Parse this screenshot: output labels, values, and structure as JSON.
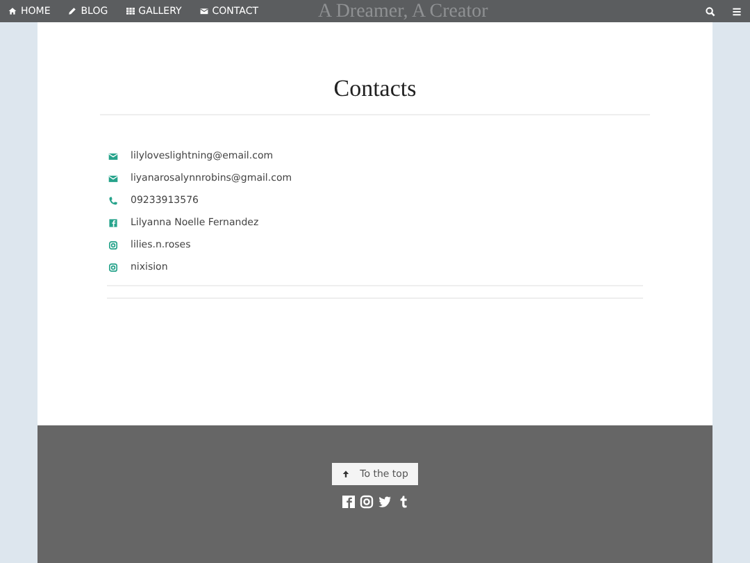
{
  "nav": {
    "items": [
      {
        "label": "HOME",
        "kind": "home"
      },
      {
        "label": "BLOG",
        "kind": "pencil"
      },
      {
        "label": "GALLERY",
        "kind": "grid"
      },
      {
        "label": "CONTACT",
        "kind": "mail"
      }
    ],
    "site_title": "A Dreamer, A Creator"
  },
  "page": {
    "heading": "Contacts",
    "contacts": [
      {
        "kind": "email",
        "text": "lilyloveslightning@email.com"
      },
      {
        "kind": "email",
        "text": "liyanarosalynnrobins@gmail.com"
      },
      {
        "kind": "phone",
        "text": "09233913576"
      },
      {
        "kind": "facebook",
        "text": "Lilyanna Noelle Fernandez"
      },
      {
        "kind": "instagram",
        "text": "lilies.n.roses"
      },
      {
        "kind": "instagram",
        "text": "nixision"
      }
    ]
  },
  "footer": {
    "top_button": "To the top"
  }
}
